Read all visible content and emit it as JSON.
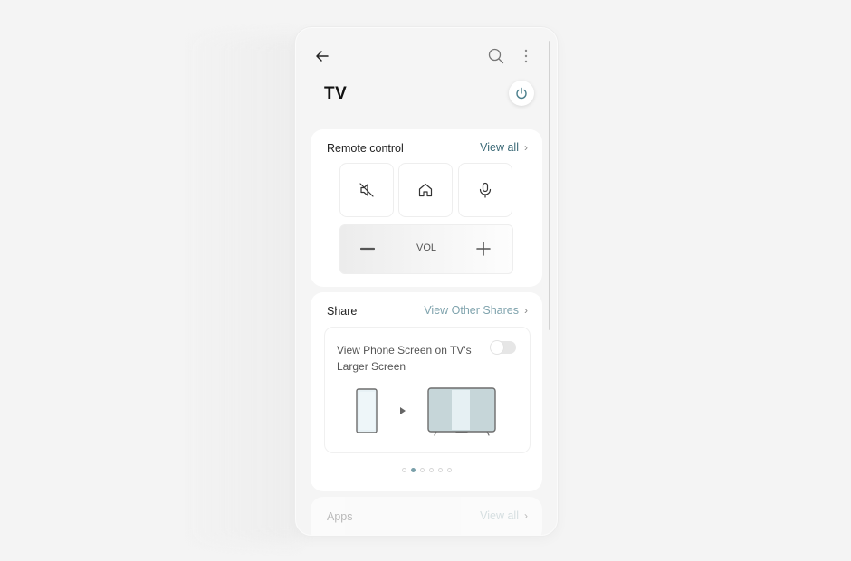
{
  "header": {
    "back_icon": "arrow-left-icon",
    "search_icon": "search-icon",
    "more_icon": "more-vertical-icon",
    "title": "TV",
    "power_icon": "power-icon"
  },
  "remote_control": {
    "title": "Remote control",
    "view_all_label": "View all",
    "keys": [
      {
        "name": "mute",
        "icon": "mute-icon"
      },
      {
        "name": "home",
        "icon": "home-icon"
      },
      {
        "name": "voice",
        "icon": "microphone-icon"
      }
    ],
    "volume": {
      "minus_icon": "minus-icon",
      "label": "VOL",
      "plus_icon": "plus-icon"
    }
  },
  "share": {
    "title": "Share",
    "view_other_label": "View Other Shares",
    "item": {
      "label": "View Phone Screen on TV's Larger Screen",
      "toggle_on": false
    },
    "pagination": {
      "total": 6,
      "active_index": 1
    }
  },
  "apps": {
    "title": "Apps",
    "view_all_label": "View all"
  },
  "colors": {
    "accent": "#3d6b78",
    "power_icon": "#4a7f8c",
    "active_dot": "#7aa0aa"
  }
}
